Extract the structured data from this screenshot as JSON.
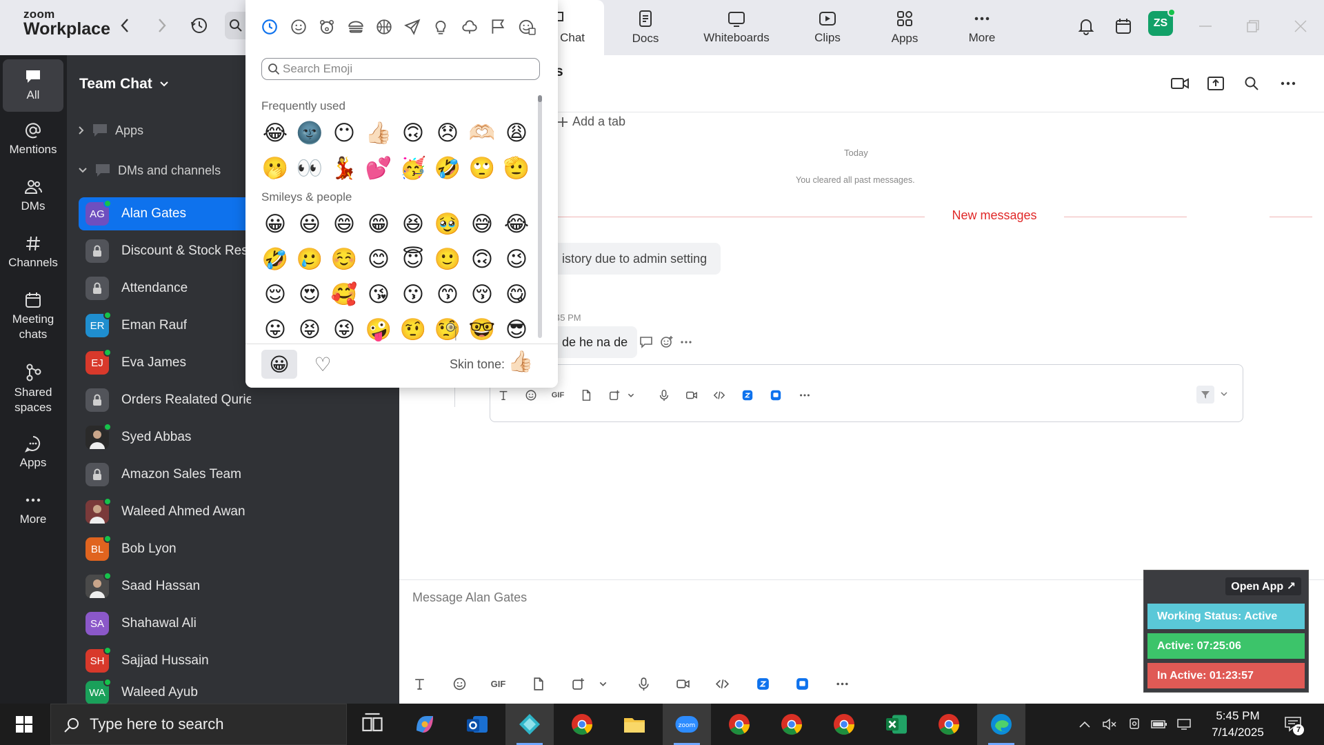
{
  "app": {
    "brand_line1": "zoom",
    "brand_line2": "Workplace",
    "user_initials": "ZS"
  },
  "top_tabs": [
    {
      "label": "Team Chat",
      "icon": "chat-icon",
      "active": true
    },
    {
      "label": "Docs",
      "icon": "docs-icon"
    },
    {
      "label": "Whiteboards",
      "icon": "whiteboard-icon"
    },
    {
      "label": "Clips",
      "icon": "clips-icon"
    },
    {
      "label": "Apps",
      "icon": "apps-icon"
    },
    {
      "label": "More",
      "icon": "more-icon"
    }
  ],
  "rail": [
    {
      "label": "All",
      "icon": "chat-bubble-icon",
      "active": true
    },
    {
      "label": "Mentions",
      "icon": "at-icon"
    },
    {
      "label": "DMs",
      "icon": "people-icon"
    },
    {
      "label": "Channels",
      "icon": "hash-icon"
    },
    {
      "label": "Meeting chats",
      "icon": "calendar-icon"
    },
    {
      "label": "Shared spaces",
      "icon": "shared-spaces-icon"
    },
    {
      "label": "Apps",
      "icon": "apps-bubble-icon"
    },
    {
      "label": "More",
      "icon": "ellipsis-icon"
    }
  ],
  "list_panel": {
    "title": "Team Chat",
    "groups": [
      "Apps",
      "DMs and channels"
    ],
    "chats": [
      {
        "name": "Alan Gates",
        "initials": "AG",
        "color": "#6e4fbf",
        "status": true,
        "selected": true
      },
      {
        "name": "Discount & Stock Reserve",
        "type": "lock"
      },
      {
        "name": "Attendance",
        "type": "lock"
      },
      {
        "name": "Eman Rauf",
        "initials": "ER",
        "color": "#1f8ecf",
        "status": true
      },
      {
        "name": "Eva James",
        "initials": "EJ",
        "color": "#d8392b",
        "status": true
      },
      {
        "name": "Orders Realated Quries",
        "type": "lock"
      },
      {
        "name": "Syed Abbas",
        "initials": "",
        "color": "#2a2a2a",
        "status": true,
        "photo": true
      },
      {
        "name": "Amazon Sales Team",
        "type": "lock"
      },
      {
        "name": "Waleed Ahmed Awan",
        "initials": "",
        "color": "#7a3a3a",
        "status": true,
        "photo": true
      },
      {
        "name": "Bob Lyon",
        "initials": "BL",
        "color": "#e0641f",
        "status": true
      },
      {
        "name": "Saad Hassan",
        "initials": "",
        "color": "#4a4a4a",
        "status": true,
        "photo": true
      },
      {
        "name": "Shahawal Ali",
        "initials": "SA",
        "color": "#8b58c9",
        "status": false
      },
      {
        "name": "Sajjad Hussain",
        "initials": "SH",
        "color": "#d8392b",
        "status": true
      },
      {
        "name": "Waleed Ayub",
        "initials": "WA",
        "color": "#1aa05a",
        "status": true
      }
    ]
  },
  "main": {
    "header_title_fragment": "s",
    "add_tab": "Add a tab",
    "date_divider": "Today",
    "cleared_note": "You cleared all past messages.",
    "new_messages": "New messages",
    "system_message": "istory due to admin setting",
    "message_time_fragment": "45 PM",
    "message_text": "de he na de",
    "composer_placeholder": "Message Alan Gates",
    "gif_label": "GIF"
  },
  "emoji_picker": {
    "search_placeholder": "Search Emoji",
    "categories": [
      "recent-icon",
      "smiley-icon",
      "animal-icon",
      "food-icon",
      "activity-icon",
      "travel-icon",
      "objects-icon",
      "symbols-icon",
      "flag-icon",
      "custom-emoji-icon"
    ],
    "sections": [
      {
        "label": "Frequently used",
        "rows": [
          [
            "😂",
            "🌚",
            "😶",
            "👍🏻",
            "🙃",
            "😞",
            "🫶🏻",
            "😩"
          ],
          [
            "🫢",
            "👀",
            "💃",
            "💕",
            "🥳",
            "🤣",
            "🙄",
            "🫡"
          ]
        ]
      },
      {
        "label": "Smileys & people",
        "rows": [
          [
            "😀",
            "😃",
            "😄",
            "😁",
            "😆",
            "🥹",
            "😅",
            "😂"
          ],
          [
            "🤣",
            "🥲",
            "☺️",
            "😊",
            "😇",
            "🙂",
            "🙃",
            "😉"
          ],
          [
            "😌",
            "😍",
            "🥰",
            "😘",
            "😗",
            "😙",
            "😚",
            "😋"
          ],
          [
            "😛",
            "😝",
            "😜",
            "🤪",
            "🤨",
            "🧐",
            "🤓",
            "😎"
          ]
        ]
      }
    ],
    "footer_tabs": [
      "😀",
      "♡"
    ],
    "skin_tone_label": "Skin tone:",
    "skin_tone_emoji": "👍🏻"
  },
  "widget": {
    "open_app": "Open App ↗",
    "working_status": "Working Status: Active",
    "active_time": "Active: 07:25:06",
    "inactive_time": "In Active: 01:23:57",
    "colors": {
      "status": "#5ac8d8",
      "active": "#3cc46a",
      "inactive": "#e05a55"
    }
  },
  "taskbar": {
    "search_placeholder": "Type here to search",
    "time": "5:45 PM",
    "date": "7/14/2025",
    "notification_count": "7"
  },
  "colors": {
    "accent": "#0e72ed",
    "new_messages": "#e02828"
  }
}
